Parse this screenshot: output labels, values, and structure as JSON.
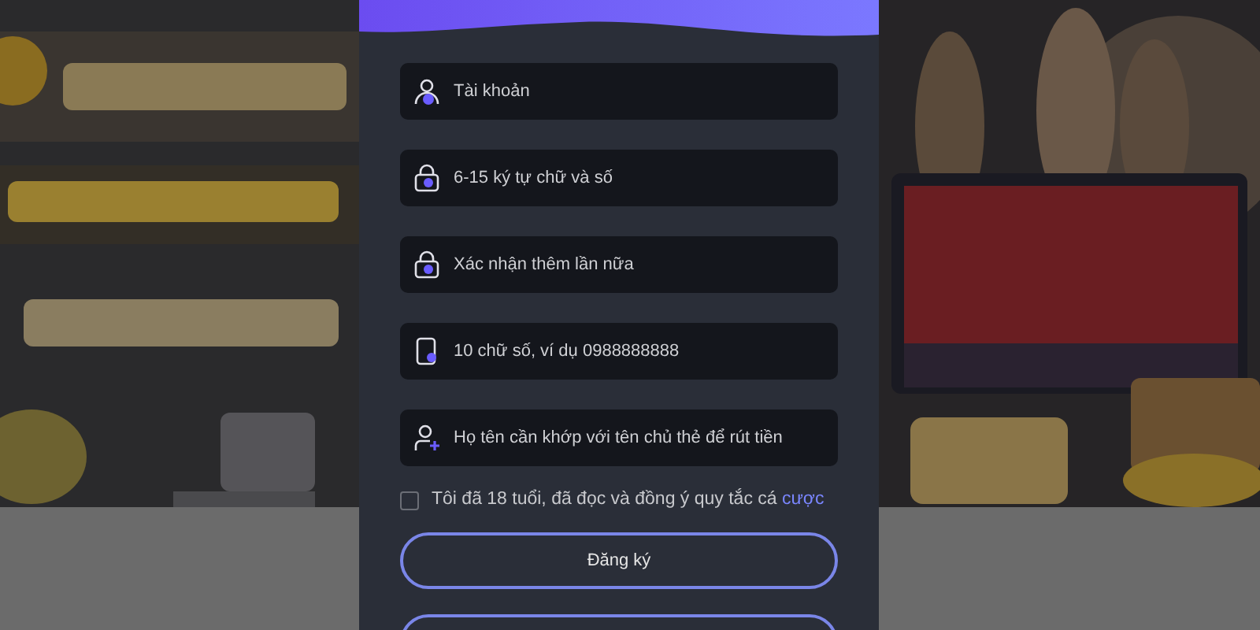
{
  "form": {
    "fields": [
      {
        "kind": "user",
        "placeholder": "Tài khoản"
      },
      {
        "kind": "lock",
        "placeholder": "6-15 ký tự chữ và số"
      },
      {
        "kind": "lock",
        "placeholder": "Xác nhận thêm lần nữa"
      },
      {
        "kind": "phone",
        "placeholder": "10 chữ số, ví dụ 0988888888"
      },
      {
        "kind": "user-add",
        "placeholder": "Họ tên cần khớp với tên chủ thẻ để rút tiền"
      }
    ],
    "agreement": {
      "checked": false,
      "text": "Tôi đã 18 tuổi, đã đọc và đồng ý quy tắc cá",
      "link": "cược"
    },
    "buttons": [
      {
        "kind": "full",
        "label": "Đăng ký"
      },
      {
        "kind": "cut-off"
      }
    ]
  }
}
